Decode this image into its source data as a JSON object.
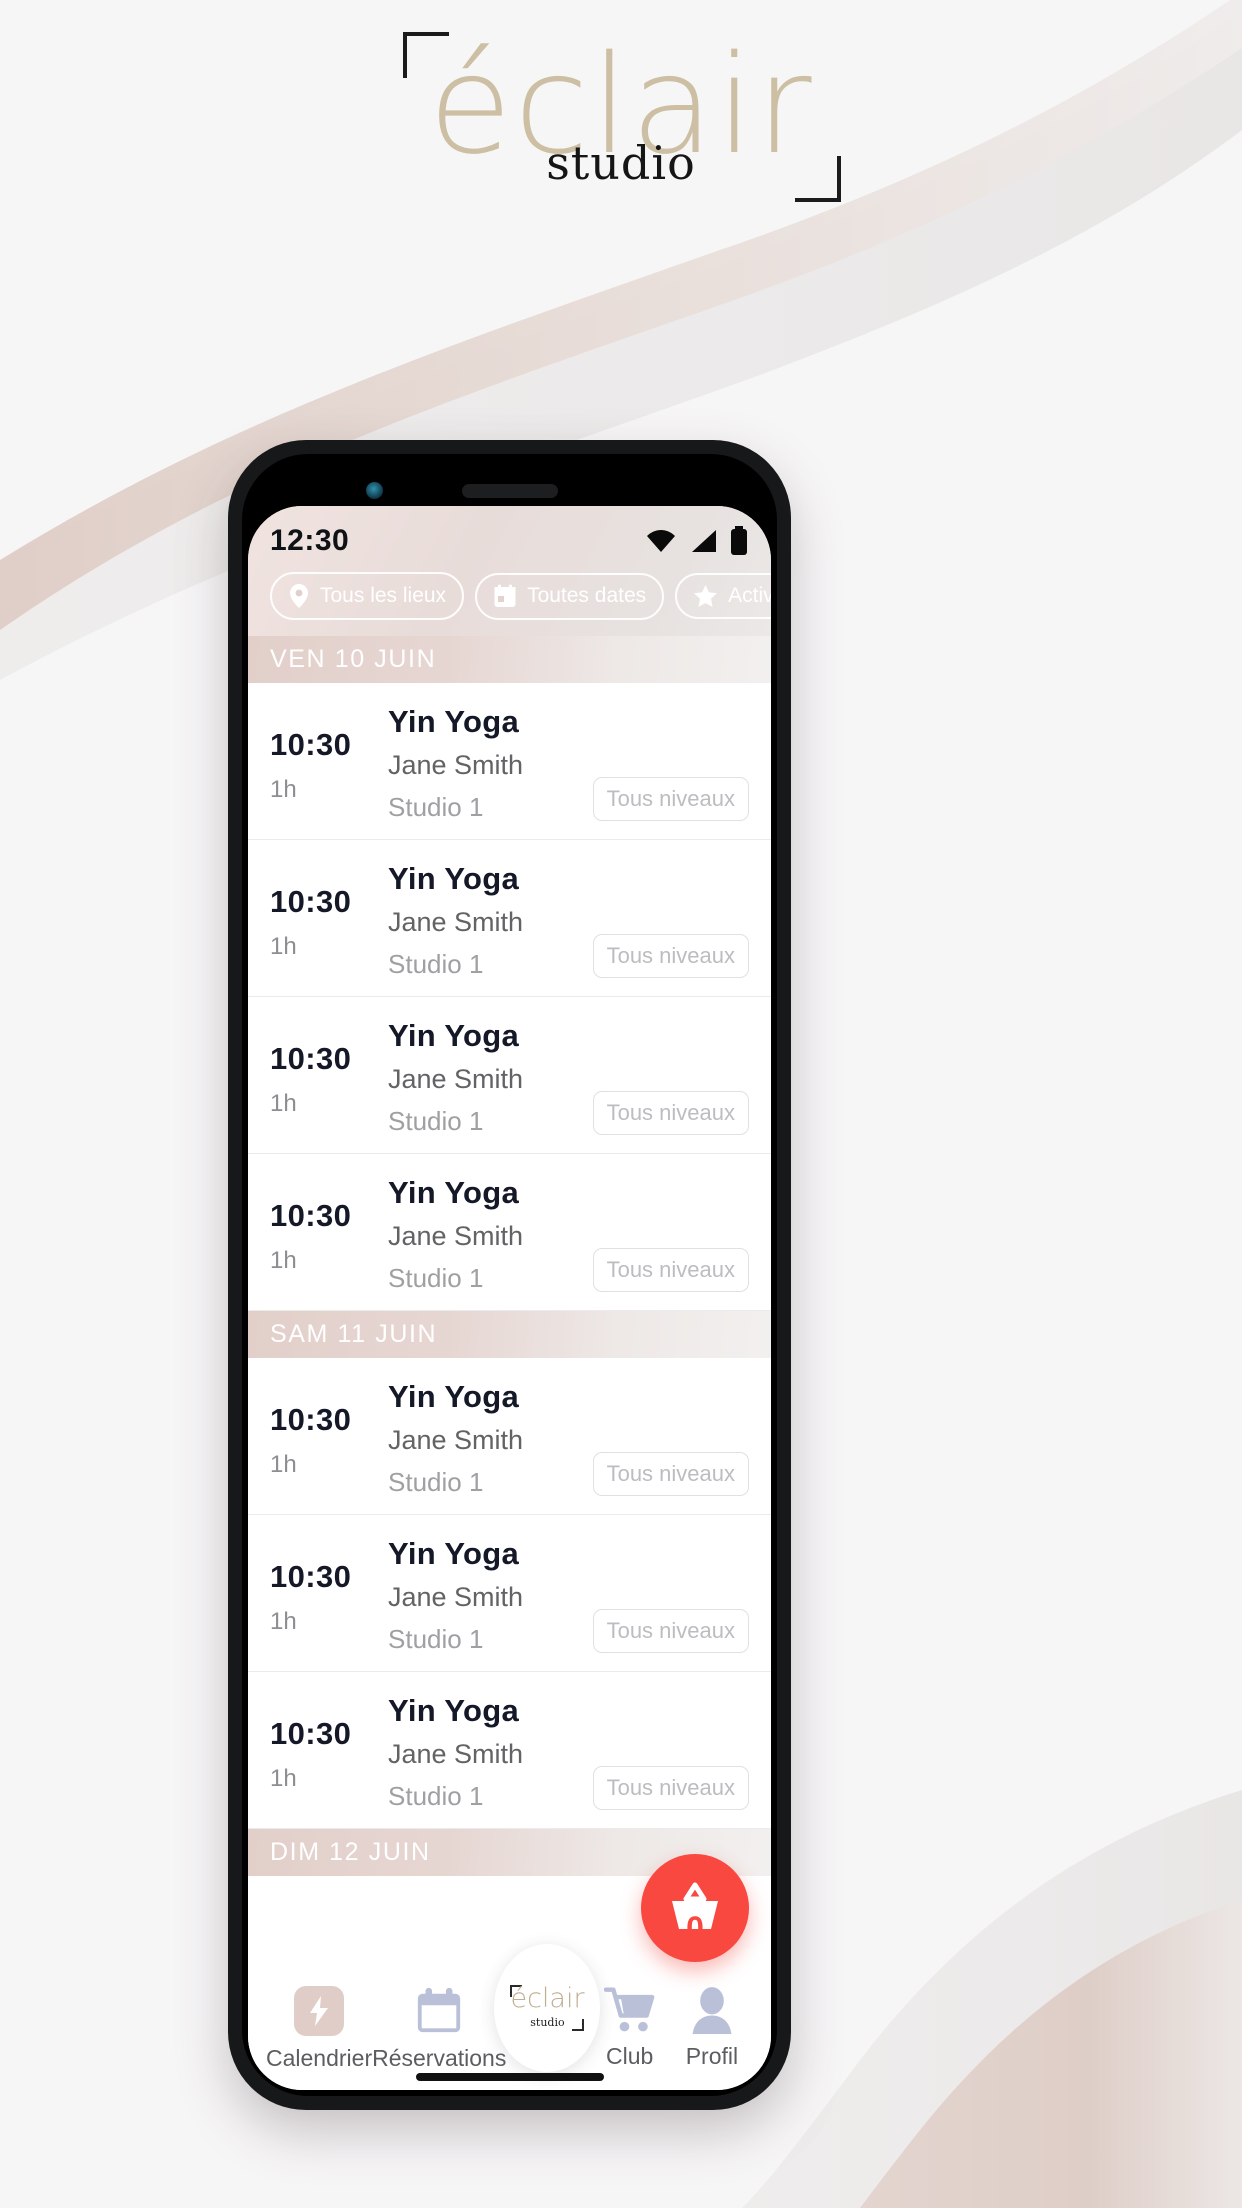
{
  "brand": {
    "word": "éclair",
    "sub": "studio",
    "accent_color": "#cdbfa4",
    "corner_color": "#1b1b1b"
  },
  "phone": {
    "status_bar": {
      "time": "12:30",
      "icons": [
        "wifi-icon",
        "cellular-signal-icon",
        "battery-icon"
      ]
    },
    "filters": [
      {
        "label": "Tous les lieux",
        "icon": "location-pin-icon"
      },
      {
        "label": "Toutes dates",
        "icon": "calendar-icon"
      },
      {
        "label": "Activités",
        "icon": "star-icon"
      }
    ],
    "schedule": [
      {
        "day": "VEN 10 JUIN",
        "classes": [
          {
            "time": "10:30",
            "duration": "1h",
            "title": "Yin Yoga",
            "instructor": "Jane Smith",
            "location": "Studio 1",
            "level": "Tous niveaux"
          },
          {
            "time": "10:30",
            "duration": "1h",
            "title": "Yin Yoga",
            "instructor": "Jane Smith",
            "location": "Studio 1",
            "level": "Tous niveaux"
          },
          {
            "time": "10:30",
            "duration": "1h",
            "title": "Yin Yoga",
            "instructor": "Jane Smith",
            "location": "Studio 1",
            "level": "Tous niveaux"
          },
          {
            "time": "10:30",
            "duration": "1h",
            "title": "Yin Yoga",
            "instructor": "Jane Smith",
            "location": "Studio 1",
            "level": "Tous niveaux"
          }
        ]
      },
      {
        "day": "SAM 11 JUIN",
        "classes": [
          {
            "time": "10:30",
            "duration": "1h",
            "title": "Yin Yoga",
            "instructor": "Jane Smith",
            "location": "Studio 1",
            "level": "Tous niveaux"
          },
          {
            "time": "10:30",
            "duration": "1h",
            "title": "Yin Yoga",
            "instructor": "Jane Smith",
            "location": "Studio 1",
            "level": "Tous niveaux"
          },
          {
            "time": "10:30",
            "duration": "1h",
            "title": "Yin Yoga",
            "instructor": "Jane Smith",
            "location": "Studio 1",
            "level": "Tous niveaux"
          }
        ]
      },
      {
        "day": "DIM 12 JUIN",
        "classes": []
      }
    ],
    "cart_fab": {
      "count": "0",
      "icon": "shopping-basket-icon",
      "color": "#f9483f"
    },
    "bottom_nav": {
      "items": [
        {
          "label": "Calendrier",
          "icon": "lightning-bolt-icon",
          "active": true
        },
        {
          "label": "Réservations",
          "icon": "calendar-icon",
          "active": false
        },
        {
          "label": "Club",
          "icon": "shopping-cart-icon",
          "active": false
        },
        {
          "label": "Profil",
          "icon": "person-icon",
          "active": false
        }
      ],
      "center_logo": {
        "word": "éclair",
        "sub": "studio"
      }
    }
  }
}
